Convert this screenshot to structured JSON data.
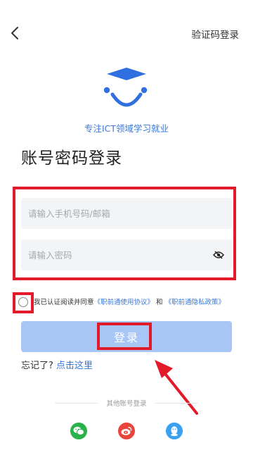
{
  "header": {
    "back_icon": "chevron-left-icon",
    "sms_login_label": "验证码登录"
  },
  "brand": {
    "logo_icon": "graduation-cap-smiley-logo",
    "slogan": "专注ICT领域学习就业",
    "accent_color": "#3b78d6"
  },
  "page_title": "账号密码登录",
  "form": {
    "phone_placeholder": "请输入手机号码/邮箱",
    "phone_value": "",
    "password_placeholder": "请输入密码",
    "password_value": "",
    "toggle_visibility_icon": "eye-slash-icon"
  },
  "agreement": {
    "prefix": "我已认证阅读并同意",
    "user_agreement": "《职前通使用协议》",
    "conjunction": "和",
    "privacy_policy": "《职前通隐私政策》"
  },
  "login_button_label": "登录",
  "forgot": {
    "prefix": "忘记了?",
    "link": "点击这里"
  },
  "other_login": {
    "label": "其他账号登录",
    "providers": [
      "wechat-icon",
      "weibo-icon",
      "qq-icon"
    ]
  },
  "annotation_color": "#e21a2a"
}
